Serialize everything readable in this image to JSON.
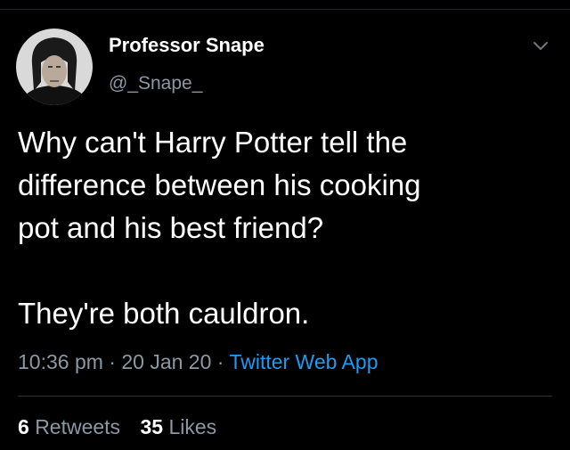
{
  "author": {
    "display_name": "Professor Snape",
    "handle": "@_Snape_",
    "avatar_icon": "portrait-avatar"
  },
  "tweet": {
    "line1": "Why can't Harry Potter tell the",
    "line2": "difference between his cooking",
    "line3": "pot and his best friend?",
    "line4": "They're both cauldron."
  },
  "meta": {
    "time": "10:36 pm",
    "separator": "·",
    "date": "20 Jan 20",
    "source": "Twitter Web App"
  },
  "stats": {
    "retweets_count": "6",
    "retweets_label": "Retweets",
    "likes_count": "35",
    "likes_label": "Likes"
  },
  "colors": {
    "background": "#000000",
    "text": "#ffffff",
    "secondary": "#8b98a5",
    "link": "#1d9bf0"
  }
}
